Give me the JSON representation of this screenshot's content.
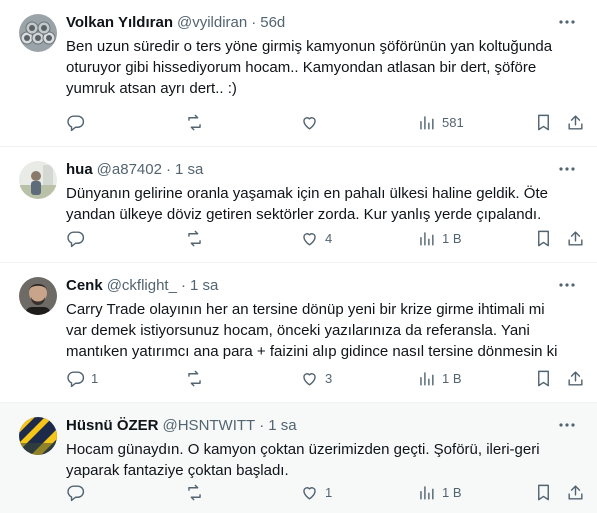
{
  "tweets": [
    {
      "name": "Volkan Yıldıran",
      "handle": "@vyildiran",
      "time": "56d",
      "text": "Ben uzun süredir o ters yöne girmiş kamyonun şöförünün yan koltuğunda oturuyor gibi hissediyorum hocam.. Kamyondan atlasan bir dert, şöföre yumruk atsan ayrı dert.. :)",
      "replies": "",
      "retweets": "",
      "likes": "",
      "views": "581",
      "avatar_icon": "pipes-avatar"
    },
    {
      "name": "hua",
      "handle": "@a87402",
      "time": "1 sa",
      "text": "Dünyanın gelirine oranla yaşamak için en pahalı ülkesi haline geldik. Öte yandan ülkeye döviz getiren sektörler zorda. Kur yanlış yerde çıpalandı.",
      "replies": "",
      "retweets": "",
      "likes": "4",
      "views": "1 B",
      "avatar_icon": "person-outdoor-avatar"
    },
    {
      "name": "Cenk",
      "handle": "@ckflight_",
      "time": "1 sa",
      "text": "Carry Trade olayının her an tersine dönüp yeni bir krize girme ihtimali mi var demek istiyorsunuz hocam, önceki yazılarınıza da referansla. Yani mantıken yatırımcı ana para + faizini alıp gidince nasıl tersine dönmesin ki",
      "replies": "1",
      "retweets": "",
      "likes": "3",
      "views": "1 B",
      "avatar_icon": "man-portrait-avatar"
    },
    {
      "name": "Hüsnü ÖZER",
      "handle": "@HSNTWITT",
      "time": "1 sa",
      "text": "Hocam günaydın. O kamyon çoktan üzerimizden geçti. Şoförü, ileri-geri yaparak fantaziye çoktan başladı.",
      "replies": "",
      "retweets": "",
      "likes": "1",
      "views": "1 B",
      "avatar_icon": "yellow-navy-stripes-avatar"
    }
  ],
  "colors": {
    "text": "#0f1419",
    "secondary": "#536471",
    "divider": "#eff3f4",
    "hover_bg": "#f7f9f9"
  }
}
